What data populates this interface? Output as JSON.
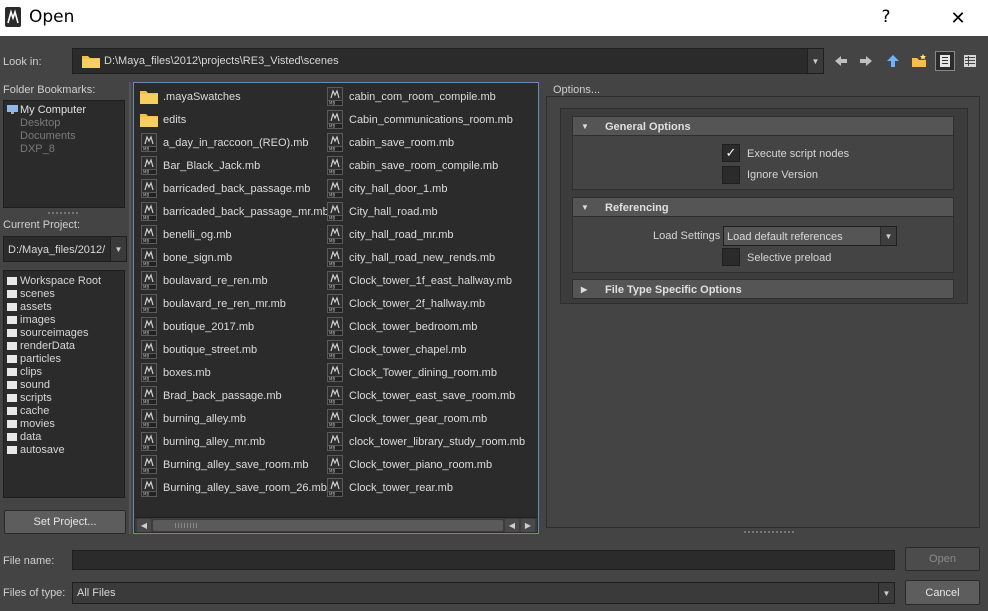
{
  "window": {
    "title": "Open",
    "help_glyph": "?",
    "close_glyph": "✕"
  },
  "lookin": {
    "label": "Look in:",
    "path": "D:\\Maya_files\\2012\\projects\\RE3_Visted\\scenes",
    "toolbar_icons": [
      "back-arrow-icon",
      "forward-arrow-icon",
      "up-folder-icon",
      "new-folder-icon",
      "list-view-icon",
      "detail-view-icon"
    ]
  },
  "bookmarks": {
    "label": "Folder Bookmarks:",
    "items": [
      {
        "label": "My Computer",
        "dim": false
      },
      {
        "label": "Desktop",
        "dim": true
      },
      {
        "label": "Documents",
        "dim": true
      },
      {
        "label": "DXP_8",
        "dim": true
      }
    ]
  },
  "project": {
    "label": "Current Project:",
    "value": "D:/Maya_files/2012/",
    "folders": [
      "Workspace Root",
      "scenes",
      "assets",
      "images",
      "sourceimages",
      "renderData",
      "particles",
      "clips",
      "sound",
      "scripts",
      "cache",
      "movies",
      "data",
      "autosave"
    ],
    "set_button": "Set Project..."
  },
  "files": {
    "col1": [
      {
        "name": ".mayaSwatches",
        "type": "folder"
      },
      {
        "name": "edits",
        "type": "folder"
      },
      {
        "name": "a_day_in_raccoon_(REO).mb",
        "type": "mb"
      },
      {
        "name": "Bar_Black_Jack.mb",
        "type": "mb"
      },
      {
        "name": "barricaded_back_passage.mb",
        "type": "mb"
      },
      {
        "name": "barricaded_back_passage_mr.mb",
        "type": "mb"
      },
      {
        "name": "benelli_og.mb",
        "type": "mb"
      },
      {
        "name": "bone_sign.mb",
        "type": "mb"
      },
      {
        "name": "boulavard_re_ren.mb",
        "type": "mb"
      },
      {
        "name": "boulavard_re_ren_mr.mb",
        "type": "mb"
      },
      {
        "name": "boutique_2017.mb",
        "type": "mb"
      },
      {
        "name": "boutique_street.mb",
        "type": "mb"
      },
      {
        "name": "boxes.mb",
        "type": "mb"
      },
      {
        "name": "Brad_back_passage.mb",
        "type": "mb"
      },
      {
        "name": "burning_alley.mb",
        "type": "mb"
      },
      {
        "name": "burning_alley_mr.mb",
        "type": "mb"
      },
      {
        "name": "Burning_alley_save_room.mb",
        "type": "mb"
      },
      {
        "name": "Burning_alley_save_room_26.mb",
        "type": "mb"
      }
    ],
    "col2": [
      {
        "name": "cabin_com_room_compile.mb",
        "type": "mb"
      },
      {
        "name": "Cabin_communications_room.mb",
        "type": "mb"
      },
      {
        "name": "cabin_save_room.mb",
        "type": "mb"
      },
      {
        "name": "cabin_save_room_compile.mb",
        "type": "mb"
      },
      {
        "name": "city_hall_door_1.mb",
        "type": "mb"
      },
      {
        "name": "City_hall_road.mb",
        "type": "mb"
      },
      {
        "name": "city_hall_road_mr.mb",
        "type": "mb"
      },
      {
        "name": "city_hall_road_new_rends.mb",
        "type": "mb"
      },
      {
        "name": "Clock_tower_1f_east_hallway.mb",
        "type": "mb"
      },
      {
        "name": "Clock_tower_2f_hallway.mb",
        "type": "mb"
      },
      {
        "name": "Clock_tower_bedroom.mb",
        "type": "mb"
      },
      {
        "name": "Clock_tower_chapel.mb",
        "type": "mb"
      },
      {
        "name": "Clock_Tower_dining_room.mb",
        "type": "mb"
      },
      {
        "name": "Clock_tower_east_save_room.mb",
        "type": "mb"
      },
      {
        "name": "Clock_tower_gear_room.mb",
        "type": "mb"
      },
      {
        "name": "clock_tower_library_study_room.mb",
        "type": "mb"
      },
      {
        "name": "Clock_tower_piano_room.mb",
        "type": "mb"
      },
      {
        "name": "Clock_tower_rear.mb",
        "type": "mb"
      }
    ]
  },
  "options": {
    "label": "Options...",
    "general": {
      "title": "General Options",
      "execute_script_nodes": {
        "label": "Execute script nodes",
        "checked": true
      },
      "ignore_version": {
        "label": "Ignore Version",
        "checked": false
      }
    },
    "referencing": {
      "title": "Referencing",
      "load_settings_label": "Load Settings",
      "load_settings_value": "Load default references",
      "selective_preload": {
        "label": "Selective preload",
        "checked": false
      }
    },
    "file_type": {
      "title": "File Type Specific Options"
    }
  },
  "bottom": {
    "file_name_label": "File name:",
    "file_name_value": "",
    "file_type_label": "Files of type:",
    "file_type_value": "All Files",
    "open_button": "Open",
    "cancel_button": "Cancel"
  }
}
